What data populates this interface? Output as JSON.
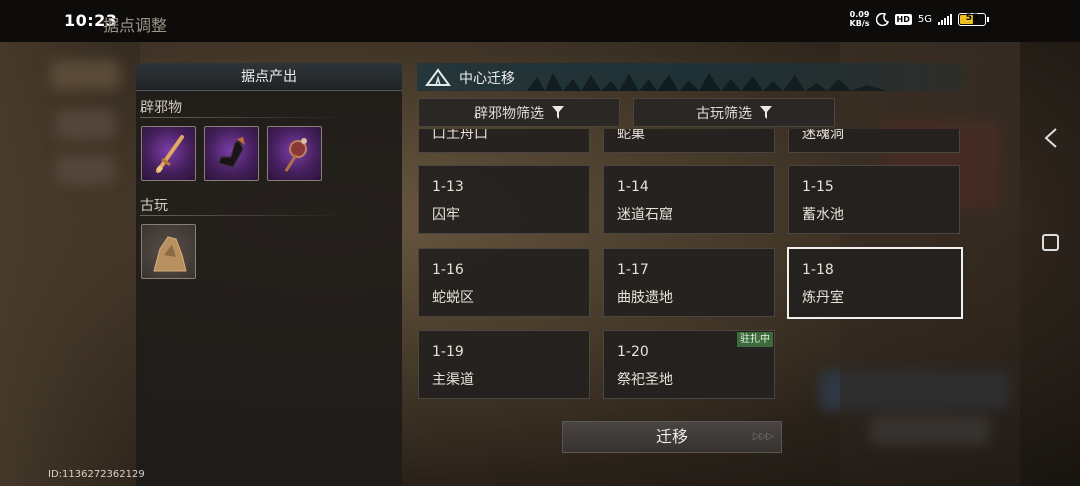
{
  "status_bar": {
    "time": "10:23",
    "net_speed_value": "0.09",
    "net_speed_unit": "KB/s",
    "hd": "HD",
    "network": "5G",
    "battery": "55"
  },
  "page_title": "据点调整",
  "left_panel": {
    "title": "据点产出",
    "sections": [
      {
        "label": "辟邪物",
        "items": [
          "sword-item",
          "boot-item",
          "charm-item"
        ]
      },
      {
        "label": "古玩",
        "items": [
          "statue-item"
        ]
      }
    ]
  },
  "right_panel": {
    "title": "中心迁移",
    "filters": [
      {
        "label": "辟邪物筛选"
      },
      {
        "label": "古玩筛选"
      }
    ],
    "partial_row": [
      {
        "name": "口土舟口"
      },
      {
        "name": "蛇巢"
      },
      {
        "name": "迷魂洞"
      }
    ],
    "locations": [
      {
        "code": "1-13",
        "name": "囚牢"
      },
      {
        "code": "1-14",
        "name": "迷道石窟"
      },
      {
        "code": "1-15",
        "name": "蓄水池"
      },
      {
        "code": "1-16",
        "name": "蛇蜕区"
      },
      {
        "code": "1-17",
        "name": "曲肢遗地"
      },
      {
        "code": "1-18",
        "name": "炼丹室"
      },
      {
        "code": "1-19",
        "name": "主渠道"
      },
      {
        "code": "1-20",
        "name": "祭祀圣地",
        "badge": "驻扎中"
      }
    ],
    "selected": "1-18",
    "migrate_label": "迁移",
    "migrate_arrows": "▷▷▷"
  },
  "footer": {
    "id_text": "ID:1136272362129"
  },
  "colors": {
    "badge_green": "#3c6b3e",
    "battery_yellow": "#f0c020",
    "header_teal": "#24363a"
  }
}
